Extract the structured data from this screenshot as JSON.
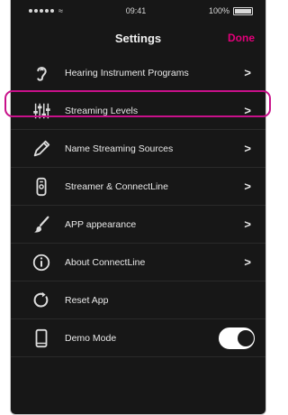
{
  "status": {
    "time": "09:41",
    "battery": "100%"
  },
  "nav": {
    "title": "Settings",
    "done_label": "Done"
  },
  "menu": [
    {
      "label": "Hearing Instrument Programs",
      "icon": "ear-icon",
      "chevron": ">"
    },
    {
      "label": "Streaming Levels",
      "icon": "sliders-icon",
      "chevron": ">"
    },
    {
      "label": "Name Streaming Sources",
      "icon": "pencil-icon",
      "chevron": ">"
    },
    {
      "label": "Streamer & ConnectLine",
      "icon": "streamer-icon",
      "chevron": ">"
    },
    {
      "label": "APP appearance",
      "icon": "brush-icon",
      "chevron": ">"
    },
    {
      "label": "About ConnectLine",
      "icon": "info-icon",
      "chevron": ">"
    },
    {
      "label": "Reset App",
      "icon": "reset-icon"
    },
    {
      "label": "Demo Mode",
      "icon": "phone-icon",
      "toggle": true
    }
  ],
  "colors": {
    "accent": "#e2007a",
    "background": "#171717",
    "highlight": "#c8118a"
  }
}
